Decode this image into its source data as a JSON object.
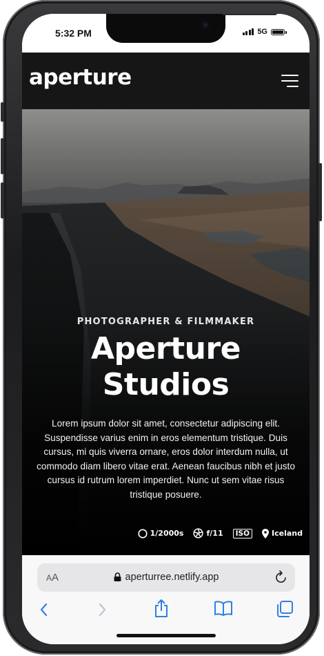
{
  "status_bar": {
    "time": "5:32 PM",
    "network": "5G"
  },
  "site": {
    "logo": "aperture",
    "menu_icon": "hamburger-menu-icon"
  },
  "hero": {
    "kicker": "PHOTOGRAPHER & FILMMAKER",
    "title_line1": "Aperture",
    "title_line2": "Studios",
    "description": "Lorem ipsum dolor sit amet, consectetur adipiscing elit. Suspendisse varius enim in eros elementum tristique. Duis cursus, mi quis viverra ornare, eros dolor interdum nulla, ut commodo diam libero vitae erat. Aenean faucibus nibh et justo cursus id rutrum lorem imperdiet. Nunc ut sem vitae risus tristique posuere.",
    "specs": {
      "shutter": "1/2000s",
      "aperture": "f/11",
      "iso_badge": "ISO",
      "location": "Iceland"
    }
  },
  "browser": {
    "text_size_label_big": "A",
    "text_size_label_small": "A",
    "url": "aperturree.netlify.app",
    "toolbar_icons": [
      "back-icon",
      "forward-icon",
      "share-icon",
      "bookmarks-icon",
      "tabs-icon"
    ]
  }
}
